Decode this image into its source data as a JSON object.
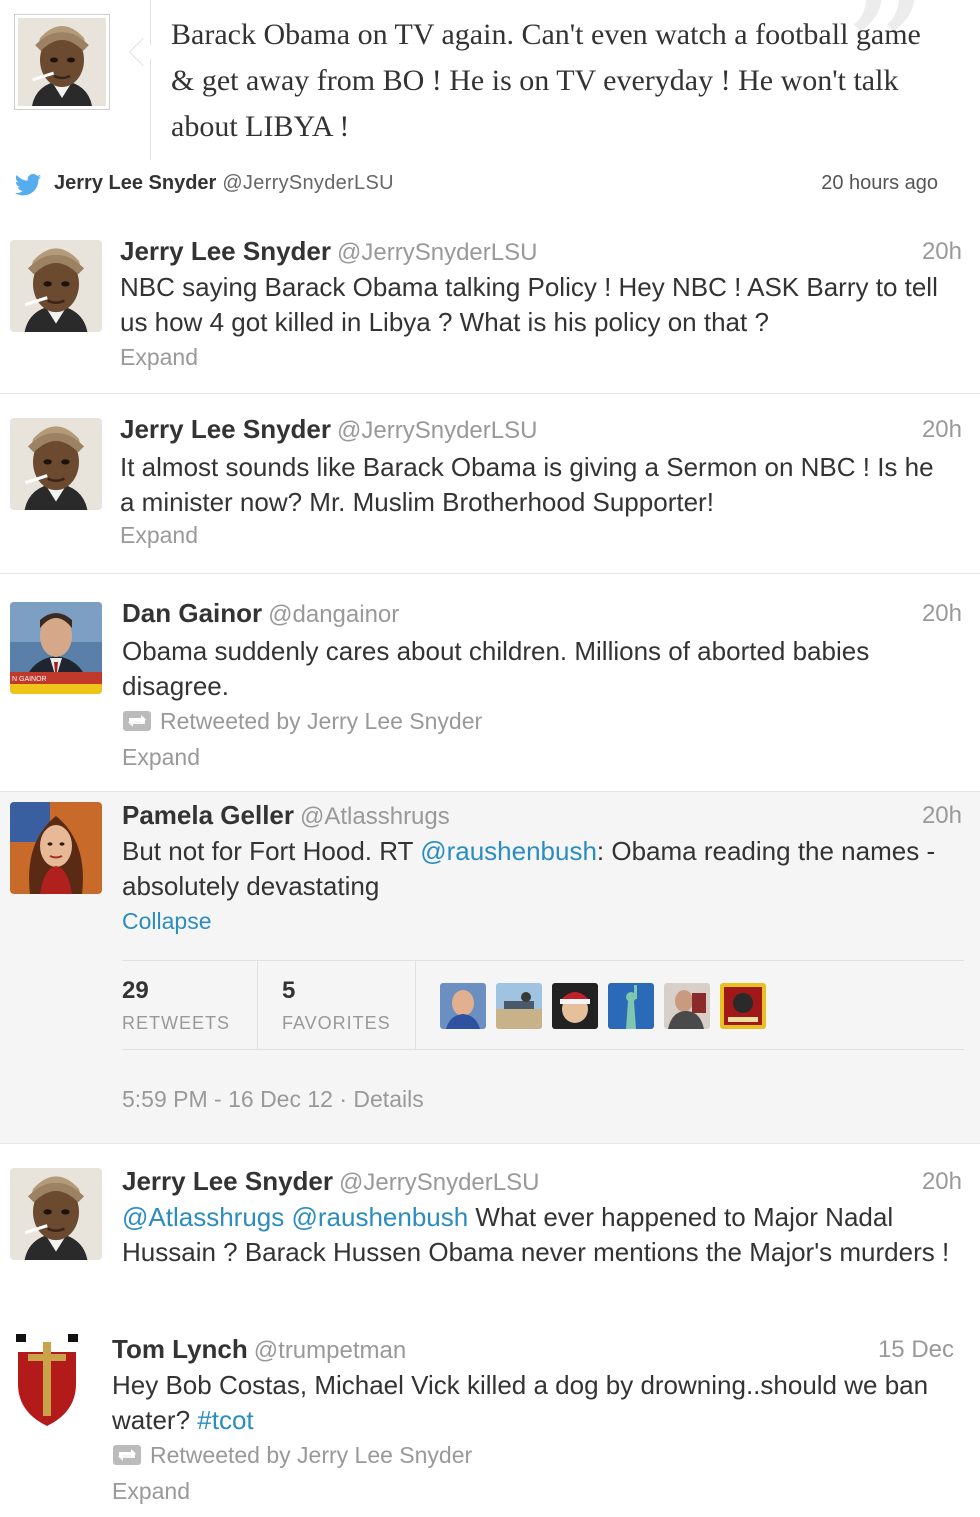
{
  "embed": {
    "text": "Barack Obama on TV again. Can't even watch a football game & get away from BO ! He is on TV everyday ! He won't talk about LIBYA !",
    "name": "Jerry Lee Snyder",
    "handle": "@JerrySnyderLSU",
    "time_ago": "20 hours ago",
    "avatar_icon": "obama-caricature-avatar",
    "bird_icon": "twitter-bird-icon",
    "bird_color": "#55acee"
  },
  "tweets": [
    {
      "name": "Jerry Lee Snyder",
      "handle": "@JerrySnyderLSU",
      "time": "20h",
      "text": "NBC saying Barack Obama talking Policy ! Hey NBC ! ASK Barry to tell us how 4 got killed in Libya ? What is his policy on that ?",
      "action": "Expand"
    },
    {
      "name": "Jerry Lee Snyder",
      "handle": "@JerrySnyderLSU",
      "time": "20h",
      "text": "It almost sounds like Barack Obama is giving a Sermon on NBC ! Is he a minister now? Mr. Muslim Brotherhood Supporter!",
      "action": "Expand"
    },
    {
      "name": "Dan Gainor",
      "handle": "@dangainor",
      "time": "20h",
      "text": "Obama suddenly cares about children. Millions of aborted babies disagree.",
      "retweeted_by": "Retweeted by Jerry Lee Snyder",
      "action": "Expand",
      "lower_third": "N GAINOR"
    },
    {
      "name": "Pamela Geller",
      "handle": "@Atlasshrugs",
      "time": "20h",
      "text_before": "But not for Fort Hood. RT ",
      "mention": "@raushenbush",
      "text_after": ": Obama reading the names - absolutely devastating",
      "action": "Collapse",
      "retweets_count": "29",
      "retweets_label": "RETWEETS",
      "favorites_count": "5",
      "favorites_label": "FAVORITES",
      "timestamp": "5:59 PM - 16 Dec 12",
      "details_link": "Details"
    },
    {
      "name": "Jerry Lee Snyder",
      "handle": "@JerrySnyderLSU",
      "time": "20h",
      "mention1": "@Atlasshrugs",
      "mention2": "@raushenbush",
      "text": " What ever happened to Major Nadal Hussain ? Barack Hussen Obama never mentions the Major's murders !"
    },
    {
      "name": "Tom Lynch",
      "handle": "@trumpetman",
      "time": "15 Dec",
      "text": "Hey Bob Costas, Michael Vick killed a dog by drowning..should we ban water? ",
      "hashtag": "#tcot",
      "retweeted_by": "Retweeted by Jerry Lee Snyder",
      "action": "Expand"
    }
  ],
  "colors": {
    "link": "#2b8dbf",
    "muted": "#999999",
    "text": "#333333",
    "expanded_bg": "#f5f5f5"
  }
}
